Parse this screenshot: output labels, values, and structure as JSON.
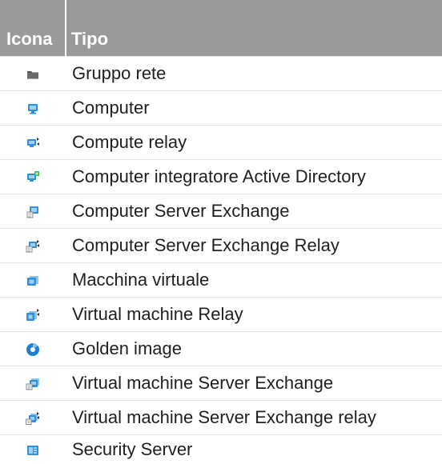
{
  "header": {
    "icon_col": "Icona",
    "type_col": "Tipo"
  },
  "colors": {
    "header_bg": "#9a9a9a",
    "header_text": "#ffffff",
    "icon_blue": "#2f8fd8",
    "icon_green": "#3cb44b",
    "folder_gray": "#555555"
  },
  "rows": [
    {
      "icon": "network-group-folder-icon",
      "label": "Gruppo rete"
    },
    {
      "icon": "computer-icon",
      "label": "Computer"
    },
    {
      "icon": "computer-relay-icon",
      "label": "Compute relay"
    },
    {
      "icon": "active-directory-integrator-icon",
      "label": "Computer integratore Active Directory"
    },
    {
      "icon": "exchange-server-computer-icon",
      "label": "Computer Server Exchange"
    },
    {
      "icon": "exchange-server-relay-computer-icon",
      "label": "Computer Server Exchange Relay"
    },
    {
      "icon": "virtual-machine-icon",
      "label": "Macchina virtuale"
    },
    {
      "icon": "virtual-machine-relay-icon",
      "label": "Virtual machine Relay"
    },
    {
      "icon": "golden-image-icon",
      "label": "Golden image"
    },
    {
      "icon": "exchange-server-vm-icon",
      "label": "Virtual machine Server Exchange"
    },
    {
      "icon": "exchange-server-vm-relay-icon",
      "label": "Virtual machine Server Exchange relay"
    },
    {
      "icon": "security-server-icon",
      "label": "Security Server"
    }
  ]
}
